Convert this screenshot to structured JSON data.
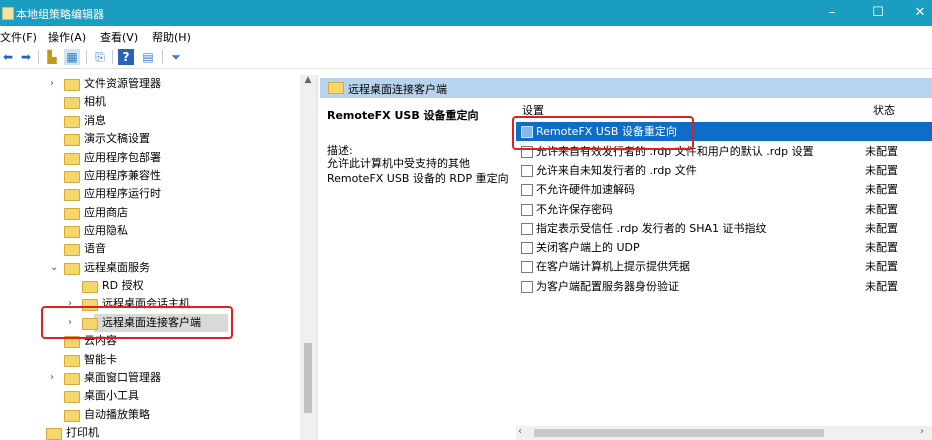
{
  "window": {
    "title": "本地组策略编辑器",
    "controls": {
      "minimize": "–",
      "maximize": "☐",
      "close": "✕"
    }
  },
  "menu": [
    {
      "label": "文件(F)"
    },
    {
      "label": "操作(A)"
    },
    {
      "label": "查看(V)"
    },
    {
      "label": "帮助(H)"
    }
  ],
  "toolbar": {
    "icons": [
      "back-arrow-icon",
      "forward-arrow-icon",
      "up-folder-icon",
      "show-hide-tree-icon",
      "export-list-icon",
      "help-icon",
      "properties-icon",
      "filter-icon"
    ]
  },
  "tree": {
    "items": [
      {
        "label": "文件资源管理器",
        "expander": "›"
      },
      {
        "label": "相机",
        "expander": ""
      },
      {
        "label": "消息",
        "expander": ""
      },
      {
        "label": "演示文稿设置",
        "expander": ""
      },
      {
        "label": "应用程序包部署",
        "expander": ""
      },
      {
        "label": "应用程序兼容性",
        "expander": ""
      },
      {
        "label": "应用程序运行时",
        "expander": ""
      },
      {
        "label": "应用商店",
        "expander": ""
      },
      {
        "label": "应用隐私",
        "expander": ""
      },
      {
        "label": "语音",
        "expander": ""
      },
      {
        "label": "远程桌面服务",
        "expander": "⌄"
      },
      {
        "label": "RD 授权",
        "expander": ""
      },
      {
        "label": "远程桌面会话主机",
        "expander": "›"
      },
      {
        "label": "远程桌面连接客户端",
        "expander": "›"
      },
      {
        "label": "云内容",
        "expander": ""
      },
      {
        "label": "智能卡",
        "expander": ""
      },
      {
        "label": "桌面窗口管理器",
        "expander": "›"
      },
      {
        "label": "桌面小工具",
        "expander": ""
      },
      {
        "label": "自动播放策略",
        "expander": ""
      },
      {
        "label": "打印机",
        "expander": ""
      }
    ]
  },
  "right_pane": {
    "header_title": "远程桌面连接客户端",
    "description": {
      "policy_title": "RemoteFX USB 设备重定向",
      "label": "描述:",
      "text": "允许此计算机中受支持的其他 RemoteFX USB 设备的 RDP 重定向"
    },
    "columns": {
      "setting": "设置",
      "state": "状态"
    },
    "rows": [
      {
        "name": "RemoteFX USB 设备重定向",
        "state": ""
      },
      {
        "name": "允许来自有效发行者的 .rdp 文件和用户的默认 .rdp 设置",
        "state": "未配置"
      },
      {
        "name": "允许来自未知发行者的 .rdp 文件",
        "state": "未配置"
      },
      {
        "name": "不允许硬件加速解码",
        "state": "未配置"
      },
      {
        "name": "不允许保存密码",
        "state": "未配置"
      },
      {
        "name": "指定表示受信任 .rdp 发行者的 SHA1 证书指纹",
        "state": "未配置"
      },
      {
        "name": "关闭客户端上的 UDP",
        "state": "未配置"
      },
      {
        "name": "在客户端计算机上提示提供凭据",
        "state": "未配置"
      },
      {
        "name": "为客户端配置服务器身份验证",
        "state": "未配置"
      }
    ]
  },
  "colors": {
    "titlebar": "#1a9dc1",
    "selection": "#0d6dc7",
    "pane_header": "#b8d3ee",
    "annotation": "#e02020"
  }
}
